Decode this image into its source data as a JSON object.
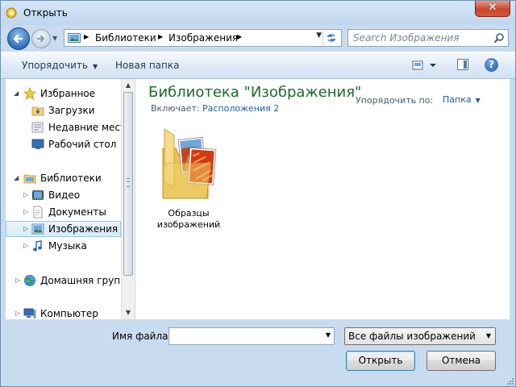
{
  "window": {
    "title": "Открыть",
    "close_label": "✕"
  },
  "nav": {
    "breadcrumbs": [
      "Библиотеки",
      "Изображения"
    ],
    "search_placeholder": "Search Изображения"
  },
  "toolbar": {
    "organize_label": "Упорядочить",
    "new_folder_label": "Новая папка"
  },
  "navpane": {
    "favorites_label": "Избранное",
    "downloads_label": "Загрузки",
    "recent_label": "Недавние места",
    "desktop_label": "Рабочий стол",
    "libraries_label": "Библиотеки",
    "video_label": "Видео",
    "documents_label": "Документы",
    "images_label": "Изображения",
    "music_label": "Музыка",
    "homegroup_label": "Домашняя группа",
    "computer_label": "Компьютер"
  },
  "content": {
    "title": "Библиотека \"Изображения\"",
    "includes_label": "Включает:",
    "includes_link": "Расположения 2",
    "arrange_label": "Упорядочить по:",
    "arrange_value": "Папка",
    "items": [
      {
        "name": "Образцы изображений"
      }
    ]
  },
  "bottom": {
    "filename_label": "Имя файла:",
    "filename_value": "",
    "filter_value": "Все файлы изображений",
    "open_label": "Открыть",
    "cancel_label": "Отмена"
  },
  "colors": {
    "title_green": "#1e6a2a",
    "link_blue": "#1f5aa8",
    "toolbar_text": "#1e395b"
  }
}
